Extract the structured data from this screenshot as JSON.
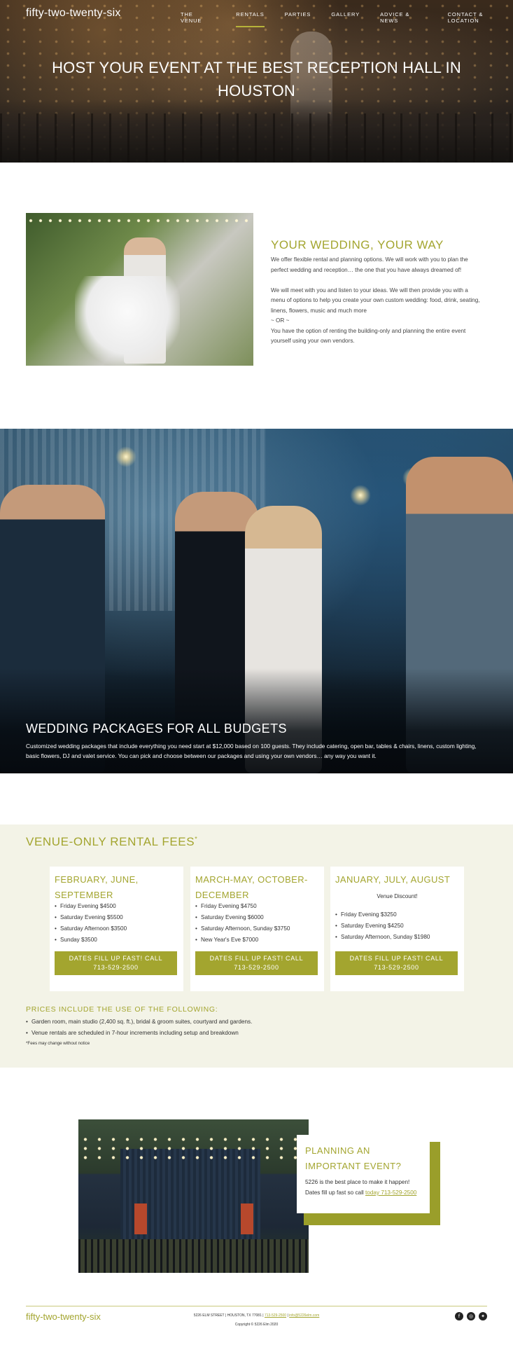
{
  "header": {
    "logo": "fifty-two-twenty-six",
    "nav": [
      "THE VENUE",
      "RENTALS",
      "PARTIES",
      "GALLERY",
      "ADVICE & NEWS",
      "CONTACT & LOCATION"
    ],
    "active_nav": "RENTALS",
    "hero_title": "HOST YOUR EVENT AT THE BEST RECEPTION HALL IN HOUSTON"
  },
  "wedding": {
    "title": "YOUR WEDDING, YOUR WAY",
    "p1": "We offer flexible rental and planning options. We will work with you to plan the perfect wedding and reception… the one that you have always dreamed of!",
    "p2": "We will meet with you and listen to your ideas. We will then provide you with a menu of options to help you create your own custom wedding: food, drink, seating, linens, flowers, music and much more",
    "or": "~ OR ~",
    "p3": "You have the option of renting the building-only and planning the entire event yourself using your own vendors."
  },
  "packages": {
    "title": "WEDDING PACKAGES FOR ALL BUDGETS",
    "text": "Customized wedding packages that include everything you need start at $12,000 based on 100 guests. They include catering, open bar, tables & chairs, linens, custom lighting, basic flowers, DJ and valet service. You can pick and choose between our packages and using your own vendors… any way you want it."
  },
  "fees": {
    "title": "VENUE-ONLY RENTAL FEES",
    "title_mark": "*",
    "cards": [
      {
        "title": "FEBRUARY, JUNE, SEPTEMBER",
        "subtitle": "",
        "items": [
          "Friday Evening $4500",
          "Saturday Evening $5500",
          "Saturday Afternoon $3500",
          "Sunday $3500"
        ],
        "button_line1": "DATES FILL UP FAST! CALL",
        "button_line2": "713-529-2500"
      },
      {
        "title": "MARCH-MAY, OCTOBER-DECEMBER",
        "subtitle": "",
        "items": [
          "Friday Evening $4750",
          "Saturday Evening $6000",
          "Saturday Afternoon, Sunday $3750",
          "New Year's Eve $7000"
        ],
        "button_line1": "DATES FILL UP FAST! CALL",
        "button_line2": "713-529-2500"
      },
      {
        "title": "JANUARY, JULY, AUGUST",
        "subtitle": "Venue Discount!",
        "items": [
          "Friday Evening $3250",
          "Saturday Evening $4250",
          "Saturday Afternoon, Sunday $1980"
        ],
        "button_line1": "DATES FILL UP FAST! CALL",
        "button_line2": "713-529-2500"
      }
    ],
    "includes_title": "PRICES INCLUDE THE USE OF THE FOLLOWING:",
    "includes": [
      "Garden room, main studio (2,400 sq. ft.), bridal & groom suites, courtyard and gardens.",
      "Venue rentals are scheduled in 7-hour increments including setup and breakdown"
    ],
    "note": "*Fees may change without notice"
  },
  "planning": {
    "title": "PLANNING AN IMPORTANT EVENT?",
    "line1": "5226 is the best place to make it happen!",
    "line2": "Dates fill up fast so call ",
    "link": "today 713-529-2500"
  },
  "footer": {
    "logo": "fifty-two-twenty-six",
    "address": "5226 ELM STREET | HOUSTON, TX 77081 | ",
    "phone": "713-529-2500",
    "sep": " | ",
    "email": "info@5226elm.com",
    "copyright": "Copyright © 5226 Elm 2020",
    "social_icons": [
      "facebook-icon",
      "instagram-icon",
      "twitter-icon"
    ]
  },
  "colors": {
    "accent": "#a3a52f",
    "band": "#f3f3e7",
    "shadow": "#9a9e2a"
  }
}
